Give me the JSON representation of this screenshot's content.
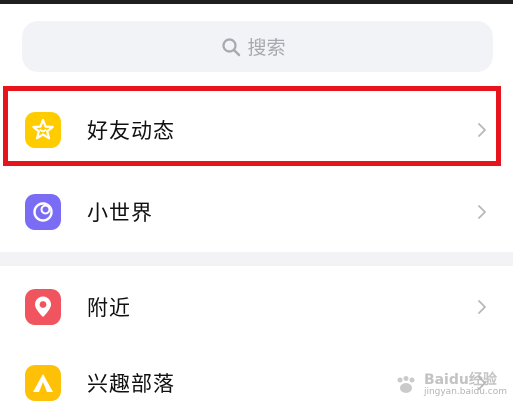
{
  "search": {
    "placeholder": "搜索",
    "icon": "search-icon"
  },
  "items": [
    {
      "label": "好友动态",
      "icon": "star-icon",
      "color": "#ffcc00"
    },
    {
      "label": "小世界",
      "icon": "moon-icon",
      "color": "#7b6cf6"
    },
    {
      "label": "附近",
      "icon": "location-pin-icon",
      "color": "#f0545e"
    },
    {
      "label": "兴趣部落",
      "icon": "tent-icon",
      "color": "#ffc107"
    }
  ],
  "highlight_color": "#e8141c",
  "watermark": {
    "brand": "Baidu经验",
    "url": "jingyan.baidu.com"
  }
}
